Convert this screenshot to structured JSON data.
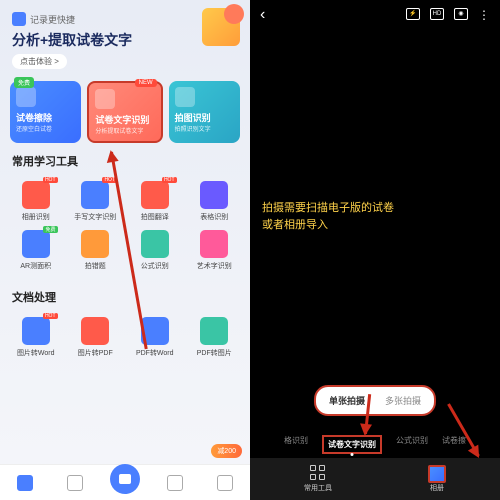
{
  "left": {
    "banner": {
      "sub": "记录更快捷",
      "title": "分析+提取试卷文字",
      "btn": "点击体验 >"
    },
    "cards": [
      {
        "badge": "免费",
        "title": "试卷擦除",
        "sub": "还原空白试卷"
      },
      {
        "badge": "NEW",
        "title": "试卷文字识别",
        "sub": "分析提取试卷文字"
      },
      {
        "title": "拍图识别",
        "sub": "拍照识别文字"
      }
    ],
    "sec1": "常用学习工具",
    "tools1": [
      {
        "label": "相册识别",
        "hot": "HOT",
        "color": "#ff5a4a"
      },
      {
        "label": "手写文字识别",
        "hot": "HOT",
        "color": "#4a7fff"
      },
      {
        "label": "拍图翻译",
        "hot": "HOT",
        "color": "#ff5a4a"
      },
      {
        "label": "表格识别",
        "color": "#6a5aff"
      },
      {
        "label": "AR测面积",
        "free": "免费",
        "color": "#4a7fff"
      },
      {
        "label": "拍错题",
        "color": "#ff9a3a"
      },
      {
        "label": "公式识别",
        "color": "#3ac5a5"
      },
      {
        "label": "艺术字识别",
        "color": "#ff5a9a"
      }
    ],
    "sec2": "文档处理",
    "tools2": [
      {
        "label": "图片转Word",
        "hot": "HOT",
        "color": "#4a7fff"
      },
      {
        "label": "图片转PDF",
        "color": "#ff5a4a"
      },
      {
        "label": "PDF转Word",
        "color": "#4a7fff"
      },
      {
        "label": "PDF转图片",
        "color": "#3ac5a5"
      }
    ],
    "coupon": "减200"
  },
  "right": {
    "topbar": {
      "hd": "HD"
    },
    "hint": "拍摄需要扫描电子版的试卷\n或者相册导入",
    "shoot": {
      "single": "单张拍摄",
      "multi": "多张拍摄"
    },
    "tabs": [
      "格识别",
      "试卷文字识别",
      "公式识别",
      "试卷擦"
    ],
    "bottom": {
      "tools": "常用工具",
      "album": "相册"
    }
  }
}
